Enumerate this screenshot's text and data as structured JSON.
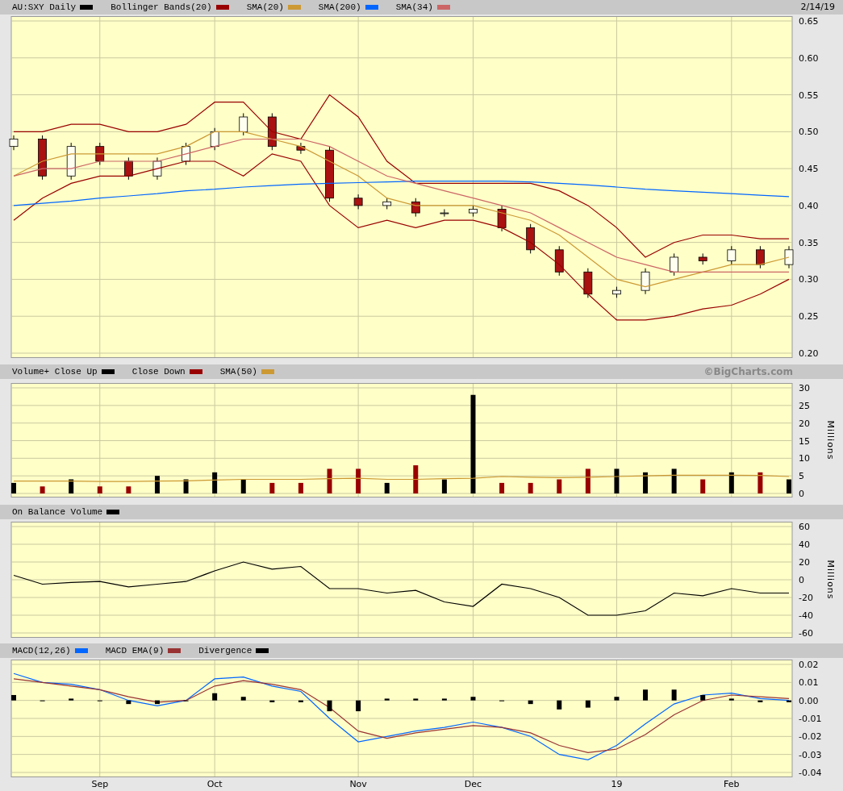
{
  "date": "2/14/19",
  "watermark": "©BigCharts.com",
  "price_panel": {
    "symbol": "AU:SXY Daily",
    "chart_data": {
      "type": "candlestick",
      "grid": true,
      "categories": [
        null,
        null,
        null,
        null,
        null,
        null,
        null,
        null,
        null,
        null,
        null,
        null,
        null,
        null,
        null,
        null,
        null,
        null,
        null,
        null,
        null,
        null,
        null,
        null,
        null,
        null,
        null,
        null
      ],
      "ohlc": [
        [
          0.48,
          0.495,
          0.475,
          0.49
        ],
        [
          0.49,
          0.495,
          0.435,
          0.44
        ],
        [
          0.44,
          0.485,
          0.435,
          0.48
        ],
        [
          0.48,
          0.485,
          0.455,
          0.46
        ],
        [
          0.46,
          0.465,
          0.435,
          0.44
        ],
        [
          0.44,
          0.465,
          0.435,
          0.46
        ],
        [
          0.46,
          0.485,
          0.455,
          0.48
        ],
        [
          0.48,
          0.505,
          0.475,
          0.5
        ],
        [
          0.5,
          0.525,
          0.495,
          0.52
        ],
        [
          0.52,
          0.525,
          0.475,
          0.48
        ],
        [
          0.48,
          0.485,
          0.47,
          0.475
        ],
        [
          0.475,
          0.48,
          0.405,
          0.41
        ],
        [
          0.41,
          0.415,
          0.395,
          0.4
        ],
        [
          0.4,
          0.41,
          0.395,
          0.405
        ],
        [
          0.405,
          0.41,
          0.385,
          0.39
        ],
        [
          0.39,
          0.395,
          0.385,
          0.39
        ],
        [
          0.39,
          0.4,
          0.385,
          0.395
        ],
        [
          0.395,
          0.4,
          0.365,
          0.37
        ],
        [
          0.37,
          0.375,
          0.335,
          0.34
        ],
        [
          0.34,
          0.345,
          0.305,
          0.31
        ],
        [
          0.31,
          0.315,
          0.275,
          0.28
        ],
        [
          0.28,
          0.29,
          0.275,
          0.285
        ],
        [
          0.285,
          0.315,
          0.28,
          0.31
        ],
        [
          0.31,
          0.335,
          0.305,
          0.33
        ],
        [
          0.33,
          0.335,
          0.32,
          0.325
        ],
        [
          0.325,
          0.345,
          0.32,
          0.34
        ],
        [
          0.34,
          0.345,
          0.315,
          0.32
        ],
        [
          0.32,
          0.345,
          0.315,
          0.34
        ]
      ],
      "ylim": [
        0.2,
        0.65
      ],
      "yticks": [
        {
          "value": 0.2,
          "label": "0.20"
        },
        {
          "value": 0.25,
          "label": "0.25"
        },
        {
          "value": 0.3,
          "label": "0.30"
        },
        {
          "value": 0.35,
          "label": "0.35"
        },
        {
          "value": 0.4,
          "label": "0.40"
        },
        {
          "value": 0.45,
          "label": "0.45"
        },
        {
          "value": 0.5,
          "label": "0.50"
        },
        {
          "value": 0.55,
          "label": "0.55"
        },
        {
          "value": 0.6,
          "label": "0.60"
        },
        {
          "value": 0.65,
          "label": "0.65"
        }
      ],
      "series": [
        {
          "name": "Bollinger Bands(20)",
          "type": "line",
          "color": "#990000",
          "values": [
            0.5,
            0.5,
            0.51,
            0.51,
            0.5,
            0.5,
            0.51,
            0.54,
            0.54,
            0.5,
            0.49,
            0.55,
            0.52,
            0.46,
            0.43,
            0.43,
            0.43,
            0.43,
            0.43,
            0.42,
            0.4,
            0.37,
            0.33,
            0.35,
            0.36,
            0.36,
            0.355,
            0.355
          ]
        },
        {
          "type": "line",
          "color": "#990000",
          "values": [
            0.38,
            0.41,
            0.43,
            0.44,
            0.44,
            0.45,
            0.46,
            0.46,
            0.44,
            0.47,
            0.46,
            0.4,
            0.37,
            0.38,
            0.37,
            0.38,
            0.38,
            0.37,
            0.35,
            0.32,
            0.28,
            0.245,
            0.245,
            0.25,
            0.26,
            0.265,
            0.28,
            0.3
          ]
        },
        {
          "name": "SMA(20)",
          "type": "line",
          "color": "#cc9933",
          "values": [
            0.44,
            0.46,
            0.47,
            0.47,
            0.47,
            0.47,
            0.48,
            0.5,
            0.5,
            0.49,
            0.48,
            0.46,
            0.44,
            0.41,
            0.4,
            0.4,
            0.4,
            0.39,
            0.38,
            0.36,
            0.33,
            0.3,
            0.29,
            0.3,
            0.31,
            0.32,
            0.32,
            0.33
          ]
        },
        {
          "name": "SMA(200)",
          "type": "line",
          "color": "#0066ff",
          "values": [
            0.4,
            0.403,
            0.406,
            0.41,
            0.413,
            0.416,
            0.42,
            0.422,
            0.425,
            0.427,
            0.429,
            0.43,
            0.431,
            0.432,
            0.433,
            0.433,
            0.433,
            0.433,
            0.432,
            0.43,
            0.428,
            0.425,
            0.422,
            0.42,
            0.418,
            0.416,
            0.414,
            0.412
          ]
        },
        {
          "name": "SMA(34)",
          "type": "line",
          "color": "#cc6666",
          "values": [
            0.44,
            0.45,
            0.45,
            0.46,
            0.46,
            0.46,
            0.47,
            0.48,
            0.49,
            0.49,
            0.49,
            0.48,
            0.46,
            0.44,
            0.43,
            0.42,
            0.41,
            0.4,
            0.39,
            0.37,
            0.35,
            0.33,
            0.32,
            0.31,
            0.31,
            0.31,
            0.31,
            0.31
          ]
        }
      ]
    }
  },
  "volume_panel": {
    "chart_data": {
      "type": "bar",
      "grid": true,
      "ylabel": "Millions",
      "ylim": [
        0,
        30
      ],
      "yticks": [
        {
          "value": 0,
          "label": "0"
        },
        {
          "value": 5,
          "label": "5"
        },
        {
          "value": 10,
          "label": "10"
        },
        {
          "value": 15,
          "label": "15"
        },
        {
          "value": 20,
          "label": "20"
        },
        {
          "value": 25,
          "label": "25"
        },
        {
          "value": 30,
          "label": "30"
        }
      ],
      "series": [
        {
          "name": "Volume+ Close Up",
          "color": "#000000",
          "values": [
            3,
            null,
            4,
            null,
            null,
            5,
            4,
            6,
            4,
            null,
            null,
            null,
            null,
            3,
            null,
            4,
            28,
            null,
            null,
            null,
            null,
            7,
            6,
            7,
            null,
            6,
            null,
            4
          ]
        },
        {
          "name": "Close Down",
          "color": "#990000",
          "values": [
            null,
            2,
            null,
            2,
            2,
            null,
            null,
            null,
            null,
            3,
            3,
            7,
            7,
            null,
            8,
            null,
            null,
            3,
            3,
            4,
            7,
            null,
            null,
            null,
            4,
            null,
            6,
            null
          ]
        },
        {
          "name": "SMA(50)",
          "type": "line",
          "color": "#cc9933",
          "values": [
            3.5,
            3.5,
            3.5,
            3.4,
            3.4,
            3.5,
            3.6,
            3.8,
            4,
            4,
            4,
            4.2,
            4.3,
            4,
            4,
            4.2,
            4.3,
            4.8,
            4.6,
            4.5,
            4.6,
            4.8,
            5,
            5.2,
            5.2,
            5.2,
            5.1,
            4.8
          ]
        }
      ]
    }
  },
  "obv_panel": {
    "chart_data": {
      "type": "line",
      "grid": true,
      "ylabel": "Millions",
      "ylim": [
        -60,
        60
      ],
      "yticks": [
        {
          "value": -60,
          "label": "-60"
        },
        {
          "value": -40,
          "label": "-40"
        },
        {
          "value": -20,
          "label": "-20"
        },
        {
          "value": 0,
          "label": "0"
        },
        {
          "value": 20,
          "label": "20"
        },
        {
          "value": 40,
          "label": "40"
        },
        {
          "value": 60,
          "label": "60"
        }
      ],
      "series": [
        {
          "name": "On Balance Volume",
          "color": "#000000",
          "values": [
            5,
            -5,
            -3,
            -2,
            -8,
            -5,
            -2,
            10,
            20,
            12,
            15,
            -10,
            -10,
            -15,
            -12,
            -25,
            -30,
            -5,
            -10,
            -20,
            -40,
            -40,
            -35,
            -15,
            -18,
            -10,
            -15,
            -15
          ]
        }
      ]
    }
  },
  "macd_panel": {
    "chart_data": {
      "type": "line",
      "grid": true,
      "categories": [
        null,
        null,
        null,
        "Sep",
        null,
        null,
        null,
        "Oct",
        null,
        null,
        null,
        null,
        "Nov",
        null,
        null,
        null,
        "Dec",
        null,
        null,
        null,
        null,
        "19",
        null,
        null,
        null,
        "Feb",
        null,
        null
      ],
      "ylim": [
        -0.04,
        0.02
      ],
      "yticks": [
        {
          "value": -0.04,
          "label": "-0.04"
        },
        {
          "value": -0.03,
          "label": "-0.03"
        },
        {
          "value": -0.02,
          "label": "-0.02"
        },
        {
          "value": -0.01,
          "label": "-0.01"
        },
        {
          "value": 0,
          "label": "0.00"
        },
        {
          "value": 0.01,
          "label": "0.01"
        },
        {
          "value": 0.02,
          "label": "0.02"
        }
      ],
      "series": [
        {
          "name": "MACD(12,26)",
          "color": "#0066ff",
          "values": [
            0.015,
            0.01,
            0.009,
            0.006,
            0,
            -0.003,
            0,
            0.012,
            0.013,
            0.008,
            0.005,
            -0.01,
            -0.023,
            -0.02,
            -0.017,
            -0.015,
            -0.012,
            -0.015,
            -0.02,
            -0.03,
            -0.033,
            -0.025,
            -0.013,
            -0.002,
            0.003,
            0.004,
            0.001,
            0
          ]
        },
        {
          "name": "MACD EMA(9)",
          "color": "#993333",
          "values": [
            0.012,
            0.01,
            0.008,
            0.006,
            0.002,
            -0.001,
            0,
            0.008,
            0.011,
            0.009,
            0.006,
            -0.004,
            -0.017,
            -0.021,
            -0.018,
            -0.016,
            -0.014,
            -0.015,
            -0.018,
            -0.025,
            -0.029,
            -0.027,
            -0.019,
            -0.008,
            0,
            0.003,
            0.002,
            0.001
          ]
        },
        {
          "name": "Divergence",
          "type": "bar",
          "color": "#000000",
          "values": [
            0.003,
            0,
            0.001,
            0,
            -0.002,
            -0.002,
            0,
            0.004,
            0.002,
            -0.001,
            -0.001,
            -0.006,
            -0.006,
            0.001,
            0.001,
            0.001,
            0.002,
            0,
            -0.002,
            -0.005,
            -0.004,
            0.002,
            0.006,
            0.006,
            0.003,
            0.001,
            -0.001,
            -0.001
          ]
        }
      ]
    }
  }
}
